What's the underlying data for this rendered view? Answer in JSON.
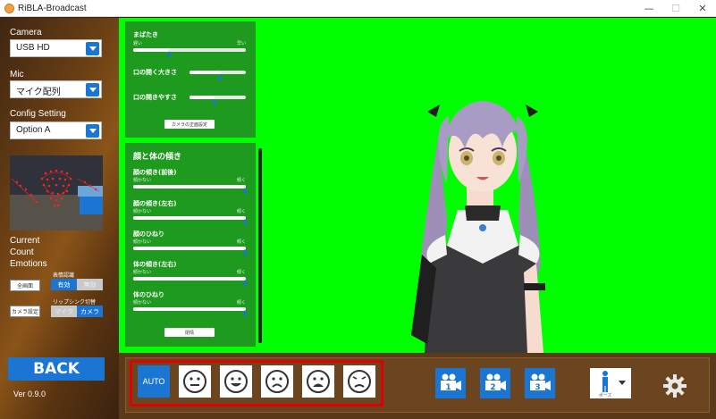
{
  "window": {
    "title": "RiBLA-Broadcast",
    "controls": [
      "—",
      "☐",
      "✕"
    ]
  },
  "left": {
    "camera_label": "Camera",
    "camera_value": "USB HD",
    "mic_label": "Mic",
    "mic_value": "マイク配列",
    "config_label": "Config Setting",
    "config_value": "Option A",
    "status_lines": [
      "Current",
      "Count",
      "Emotions"
    ],
    "fullscreen_btn": "全画面",
    "camera_settings_btn": "カメラ設定",
    "expression_label": "表情認識",
    "expression_on": "有効",
    "expression_off": "無効",
    "lipsync_label": "リップシンク切替",
    "lipsync_mic": "マイク",
    "lipsync_camera": "カメラ",
    "back_label": "BACK",
    "version": "Ver 0.9.0"
  },
  "settings": {
    "card1": {
      "sliders": [
        {
          "label": "まばたき",
          "min": "遅い",
          "max": "早い",
          "value": 0.32
        },
        {
          "label": "口の開く大きさ",
          "value": 0.55
        },
        {
          "label": "口の開きやすさ",
          "value": 0.45
        }
      ],
      "button": "カメラの正面設定"
    },
    "card2": {
      "title": "顔と体の傾き",
      "sliders": [
        {
          "label": "顔の傾き(前後)",
          "min": "傾かない",
          "max": "傾く",
          "value": 1.0
        },
        {
          "label": "顔の傾き(左右)",
          "min": "傾かない",
          "max": "傾く",
          "value": 1.0
        },
        {
          "label": "顔のひねり",
          "min": "傾かない",
          "max": "傾く",
          "value": 1.0
        },
        {
          "label": "体の傾き(左右)",
          "min": "傾かない",
          "max": "傾く",
          "value": 1.0
        },
        {
          "label": "体のひねり",
          "min": "傾かない",
          "max": "傾く",
          "value": 1.0
        }
      ],
      "button": "閉情"
    }
  },
  "bottom": {
    "auto_label": "AUTO",
    "faces": [
      "neutral-face-icon",
      "happy-face-icon",
      "sad-face-icon",
      "angry-face-icon",
      "worried-face-icon"
    ],
    "cameras": [
      "1",
      "2",
      "3"
    ],
    "pose_label": "ポーズ"
  },
  "colors": {
    "accent": "#1a76d2",
    "green_screen": "#00ff00",
    "panel_green": "#1e9a1e",
    "highlight": "#e00000"
  }
}
